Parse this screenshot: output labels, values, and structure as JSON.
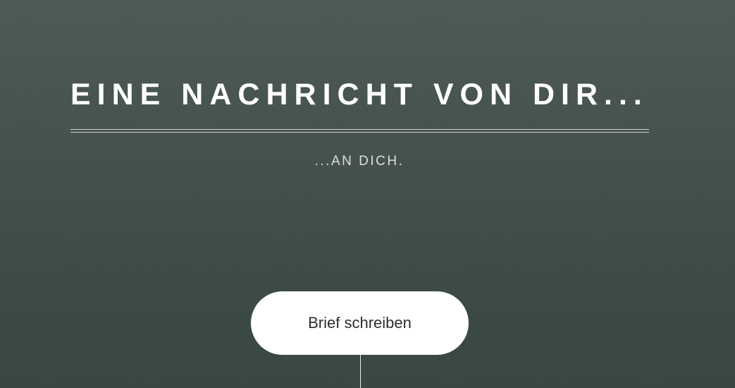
{
  "hero": {
    "title": "EINE NACHRICHT VON DIR...",
    "subtitle": "...AN DICH.",
    "cta_label": "Brief schreiben"
  },
  "colors": {
    "background_top": "#4d5a55",
    "background_bottom": "#394744",
    "text": "#ffffff",
    "button_bg": "#ffffff",
    "button_text": "#2e2e2e"
  }
}
